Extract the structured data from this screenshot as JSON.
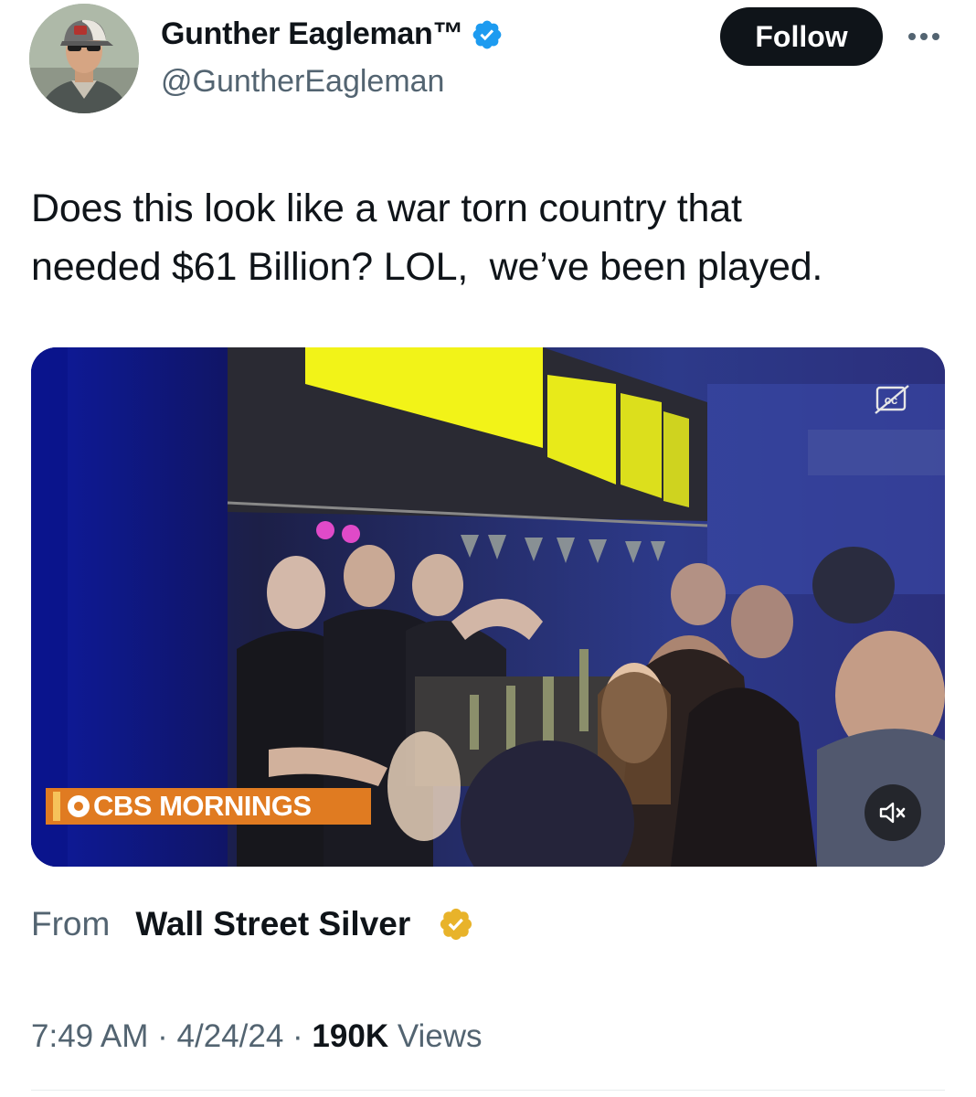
{
  "author": {
    "display_name": "Gunther Eagleman™",
    "handle": "@GuntherEagleman",
    "verified_color": "#1d9bf0"
  },
  "actions": {
    "follow_label": "Follow",
    "more_icon": "more-horizontal-icon"
  },
  "tweet": {
    "text_lines": [
      "Does this look like a war torn country that",
      "needed $61 Billion? LOL,  we’ve been played."
    ]
  },
  "media": {
    "overlay_text": "CBS MORNINGS",
    "captions_icon": "closed-captions-icon",
    "mute_icon": "muted-speaker-icon"
  },
  "source": {
    "from_label": "From",
    "name": "Wall Street Silver",
    "verified_color": "#e8b32a"
  },
  "meta": {
    "time": "7:49 AM",
    "date": "4/24/24",
    "separator": " · ",
    "views_count": "190K",
    "views_label": "Views"
  }
}
